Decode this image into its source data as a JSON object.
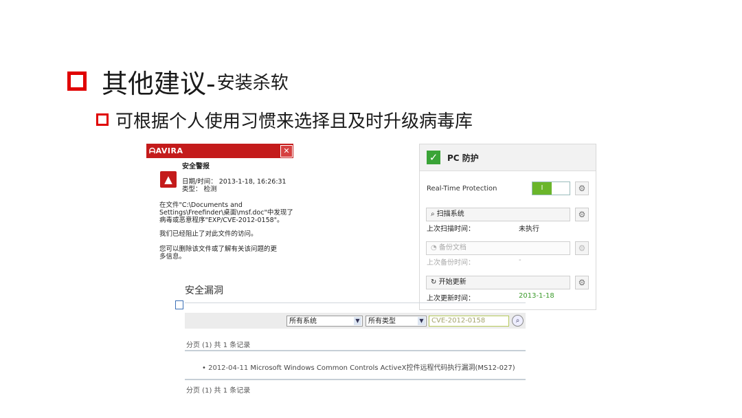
{
  "slide": {
    "title_main": "其他建议-",
    "title_sub": "安装杀软",
    "subtitle": "可根据个人使用习惯来选择且及时升级病毒库"
  },
  "avira": {
    "logo": "AVIRA",
    "close_glyph": "✕",
    "alert_title": "安全警报",
    "datetime_label": "日期/时间：",
    "datetime_value": "2013-1-18, 16:26:31",
    "type_label": "类型：",
    "type_value": "检测",
    "message_lines": [
      "在文件\"C:\\Documents and",
      "Settings\\Freefinder\\桌面\\msf.doc\"中发现了",
      "病毒或恶意程序\"EXP/CVE-2012-0158\"。"
    ],
    "blocked_text": "我们已经阻止了对此文件的访问。",
    "info_lines": [
      "您可以删除该文件或了解有关该问题的更",
      "多信息。"
    ]
  },
  "pc_protection": {
    "title": "PC 防护",
    "realtime_label": "Real-Time Protection",
    "toggle_on_label": "I",
    "scan_button": "扫描系统",
    "last_scan_label": "上次扫描时间：",
    "last_scan_value": "未执行",
    "backup_button": "备份文档",
    "last_backup_label": "上次备份时间：",
    "last_backup_value": "-",
    "update_button": "开始更新",
    "last_update_label": "上次更新时间：",
    "last_update_value": "2013-1-18"
  },
  "vulnerability": {
    "title": "安全漏洞",
    "system_select": "所有系统",
    "type_select": "所有类型",
    "search_value": "CVE-2012-0158",
    "pager_text": "分页 (1) 共 1 条记录",
    "item_date": "2012-04-11",
    "item_text": "Microsoft Windows Common Controls ActiveX控件远程代码执行漏洞(MS12-027)"
  },
  "colors": {
    "accent_red": "#e00000",
    "avira_red": "#c41b1b",
    "ok_green": "#3aa437",
    "update_green": "#3a9a2a"
  }
}
